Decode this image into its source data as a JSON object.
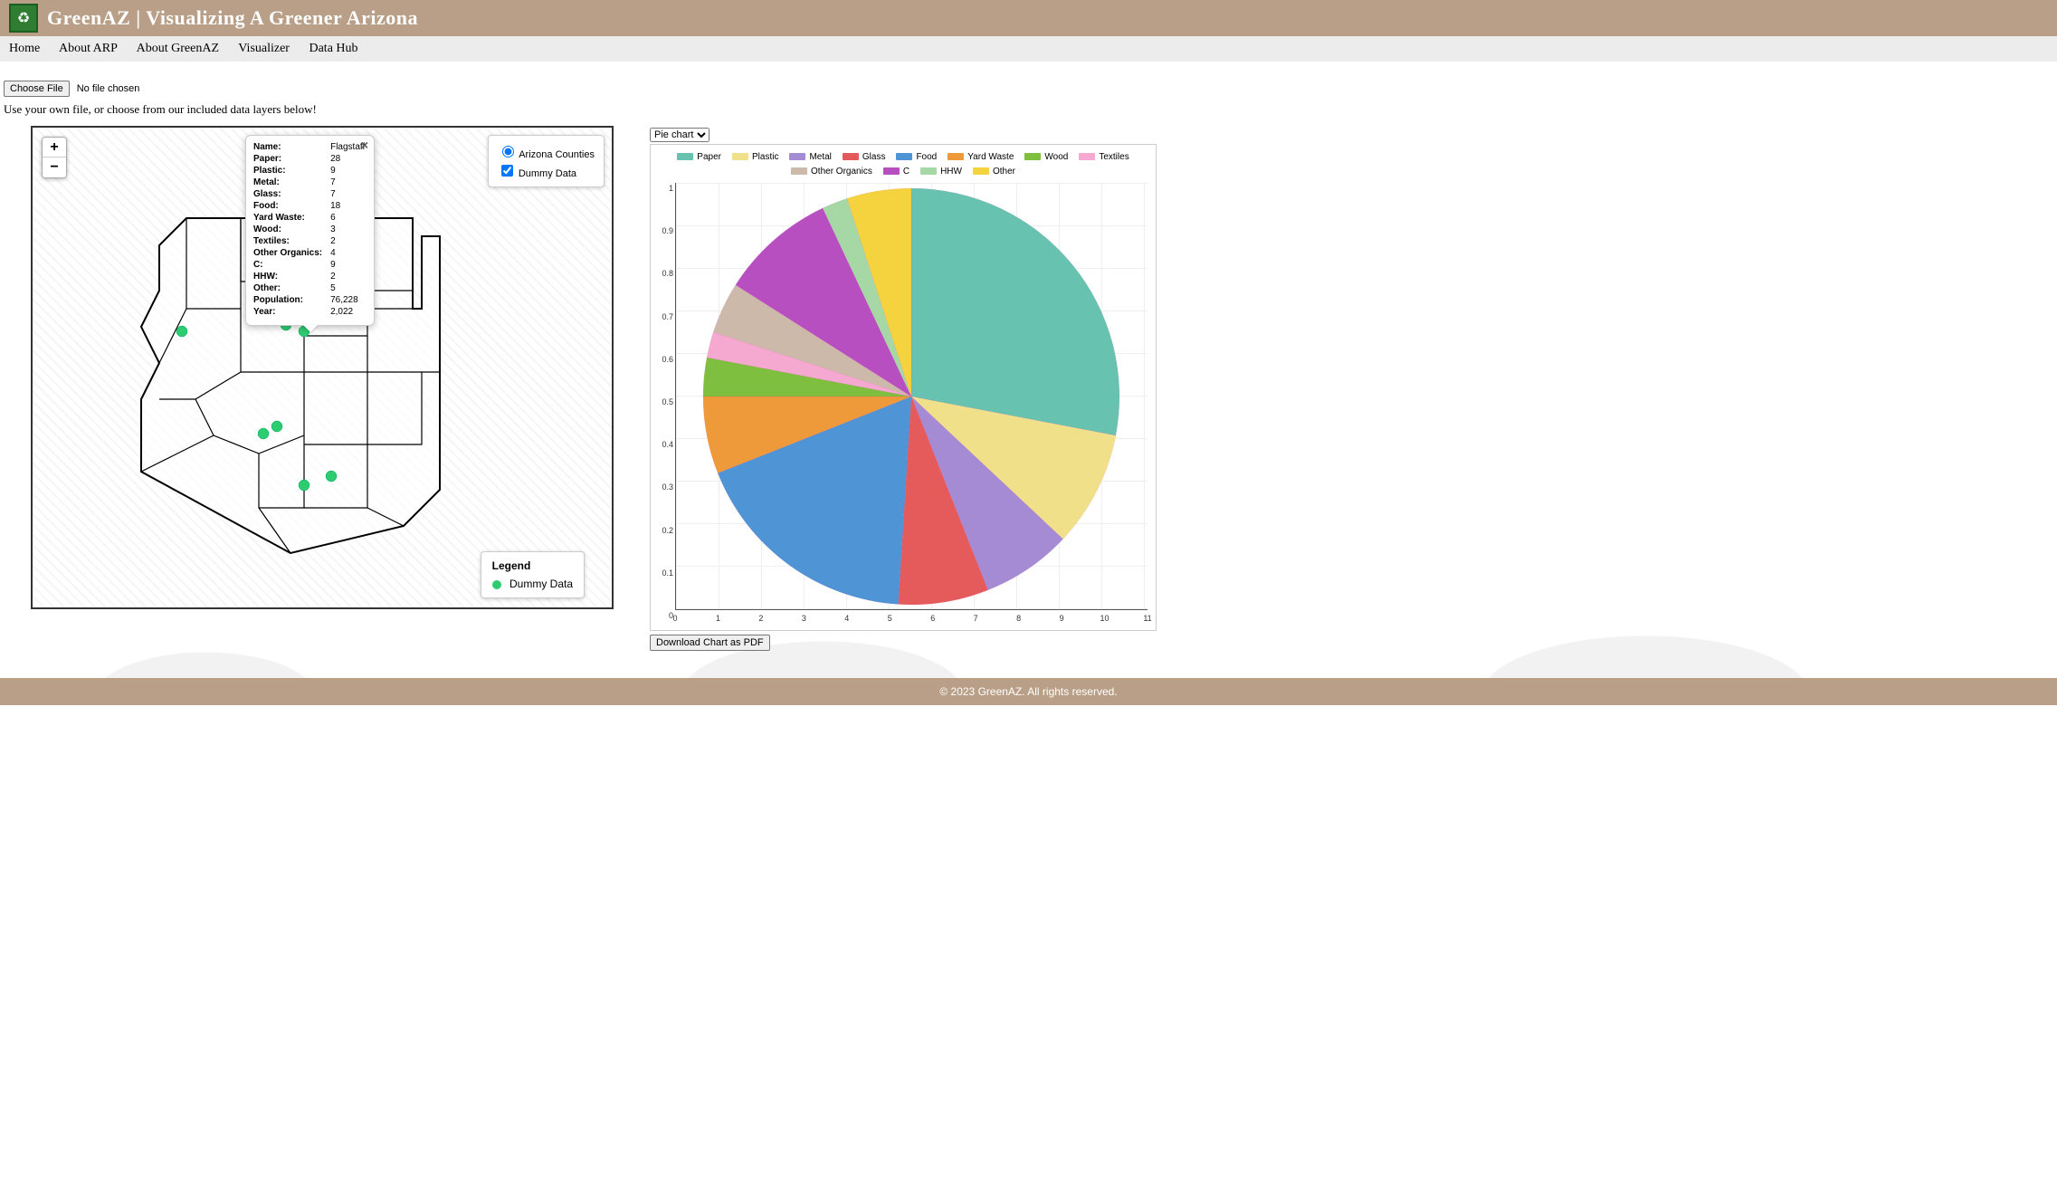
{
  "header": {
    "site_title": "GreenAZ | Visualizing A Greener Arizona"
  },
  "nav": {
    "home": "Home",
    "about_arp": "About ARP",
    "about_greenaz": "About GreenAZ",
    "visualizer": "Visualizer",
    "data_hub": "Data Hub"
  },
  "upload": {
    "choose_file": "Choose File",
    "no_file": "No file chosen",
    "hint": "Use your own file, or choose from our included data layers below!"
  },
  "map": {
    "zoom_in": "+",
    "zoom_out": "−",
    "layer_counties": "Arizona Counties",
    "layer_dummy": "Dummy Data",
    "legend_title": "Legend",
    "legend_item": "Dummy Data",
    "popup_close": "×",
    "popup_rows": [
      {
        "k": "Name:",
        "v": "Flagstaff"
      },
      {
        "k": "Paper:",
        "v": "28"
      },
      {
        "k": "Plastic:",
        "v": "9"
      },
      {
        "k": "Metal:",
        "v": "7"
      },
      {
        "k": "Glass:",
        "v": "7"
      },
      {
        "k": "Food:",
        "v": "18"
      },
      {
        "k": "Yard Waste:",
        "v": "6"
      },
      {
        "k": "Wood:",
        "v": "3"
      },
      {
        "k": "Textiles:",
        "v": "2"
      },
      {
        "k": "Other Organics:",
        "v": "4"
      },
      {
        "k": "C:",
        "v": "9"
      },
      {
        "k": "HHW:",
        "v": "2"
      },
      {
        "k": "Other:",
        "v": "5"
      },
      {
        "k": "Population:",
        "v": "76,228"
      },
      {
        "k": "Year:",
        "v": "2,022"
      }
    ]
  },
  "chart_select": {
    "value": "Pie chart"
  },
  "download": {
    "label": "Download Chart as PDF"
  },
  "footer": {
    "text": "© 2023 GreenAZ. All rights reserved."
  },
  "chart_data": {
    "type": "pie",
    "title": "",
    "xlabel": "",
    "ylabel": "",
    "xlim": [
      0,
      11
    ],
    "ylim": [
      0,
      1
    ],
    "x_ticks": [
      0,
      1,
      2,
      3,
      4,
      5,
      6,
      7,
      8,
      9,
      10,
      11
    ],
    "y_ticks": [
      0,
      0.1,
      0.2,
      0.3,
      0.4,
      0.5,
      0.6,
      0.7,
      0.8,
      0.9,
      1
    ],
    "categories": [
      "Paper",
      "Plastic",
      "Metal",
      "Glass",
      "Food",
      "Yard Waste",
      "Wood",
      "Textiles",
      "Other Organics",
      "C",
      "HHW",
      "Other"
    ],
    "values": [
      28,
      9,
      7,
      7,
      18,
      6,
      3,
      2,
      4,
      9,
      2,
      5
    ],
    "colors": {
      "Paper": "#67c2b0",
      "Plastic": "#f1e08a",
      "Metal": "#a58bd3",
      "Glass": "#e55b5b",
      "Food": "#4f94d4",
      "Yard Waste": "#ee9a3a",
      "Wood": "#7fbf3f",
      "Textiles": "#f5a8d0",
      "Other Organics": "#cdb9aa",
      "C": "#b84fc1",
      "HHW": "#a6d8a6",
      "Other": "#f4d33f"
    }
  }
}
